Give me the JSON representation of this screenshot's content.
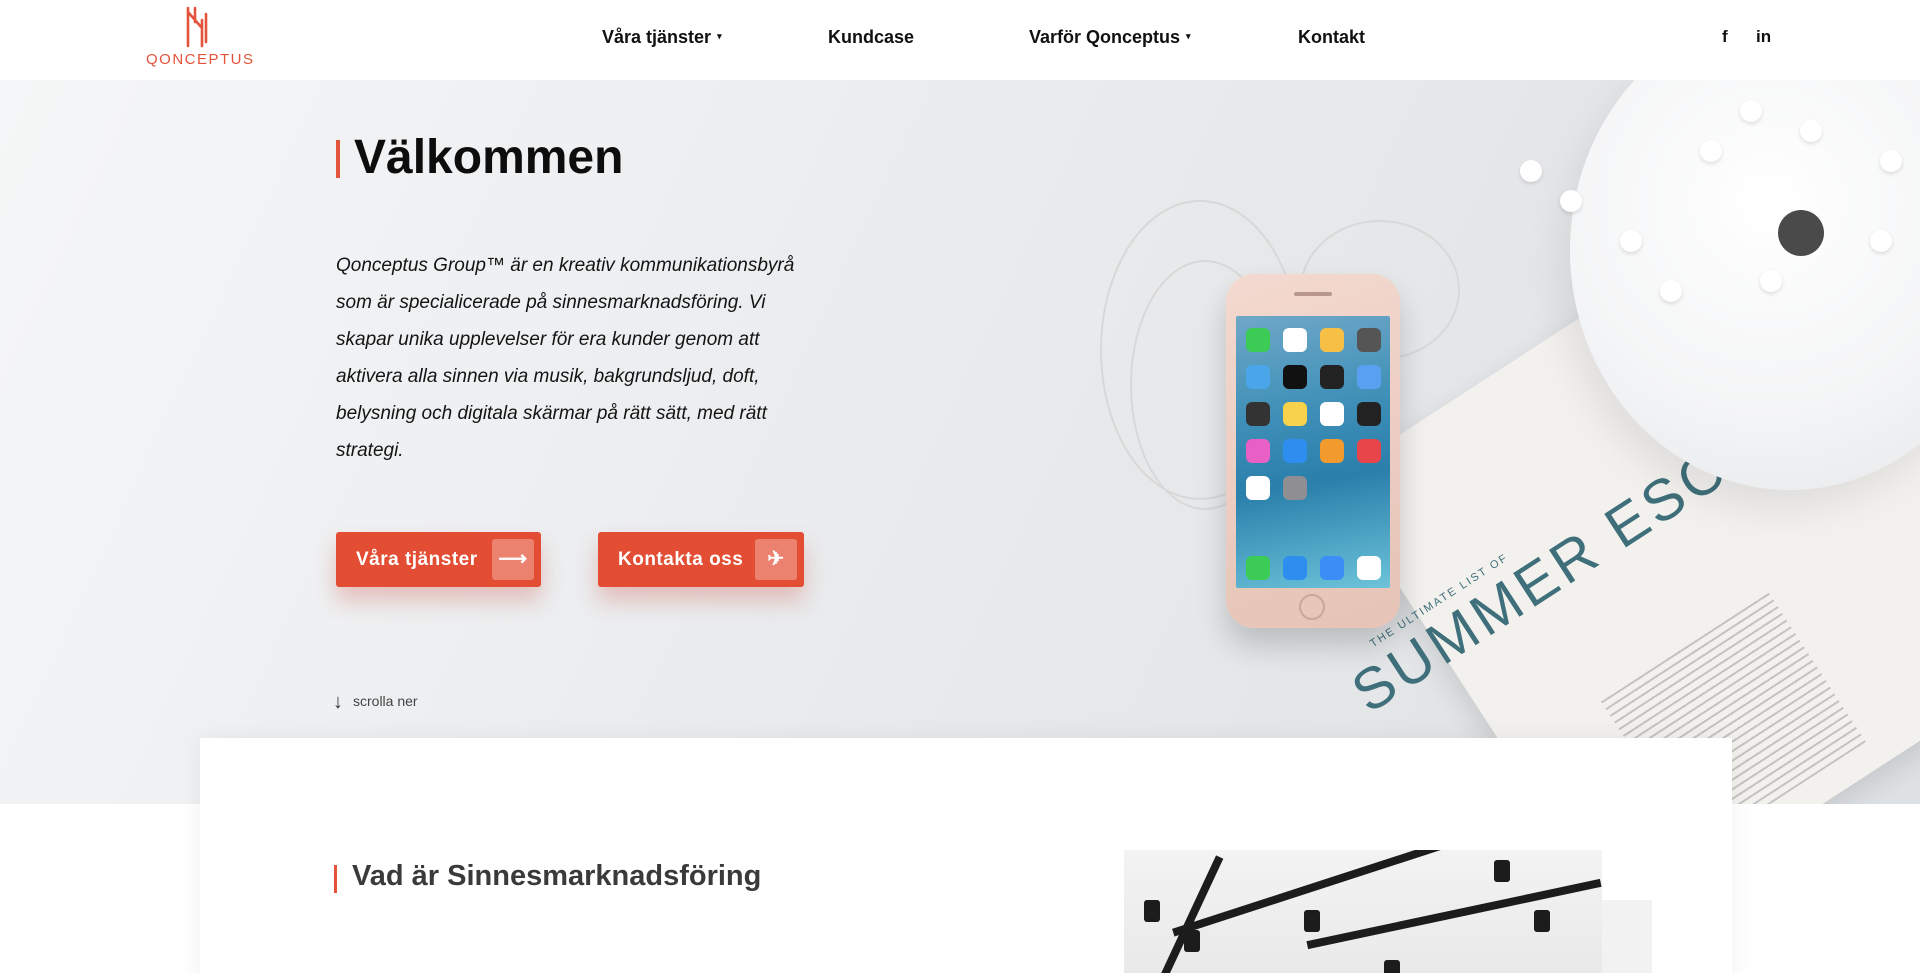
{
  "brand": {
    "name": "QONCEPTUS",
    "accent_color": "#e4533b",
    "button_color": "#e24d33"
  },
  "nav": {
    "items": [
      {
        "label": "Våra tjänster",
        "has_dropdown": true
      },
      {
        "label": "Kundcase",
        "has_dropdown": false
      },
      {
        "label": "Varför Qonceptus",
        "has_dropdown": true
      },
      {
        "label": "Kontakt",
        "has_dropdown": false
      }
    ],
    "caret": "▾"
  },
  "social": {
    "facebook": "f",
    "linkedin": "in"
  },
  "hero": {
    "title": "Välkommen",
    "text": "Qonceptus Group™ är en kreativ kommunikationsbyrå som är specialicerade på sinnesmarknadsföring. Vi skapar unika upplevelser för era kunder genom att aktivera alla sinnen via musik, bakgrundsljud, doft, belysning och digitala skärmar på rätt sätt, med rätt strategi.",
    "buttons": [
      {
        "label": "Våra tjänster",
        "icon": "arrow-right-icon",
        "glyph": "⟶"
      },
      {
        "label": "Kontakta oss",
        "icon": "paper-plane-icon",
        "glyph": "✈"
      }
    ],
    "scroll": {
      "label": "scrolla ner",
      "glyph": "↓"
    },
    "magazine": {
      "small": "THE ULTIMATE LIST OF",
      "title": "SUMMER ESCAPES"
    }
  },
  "section": {
    "title": "Vad är Sinnesmarknadsföring"
  }
}
